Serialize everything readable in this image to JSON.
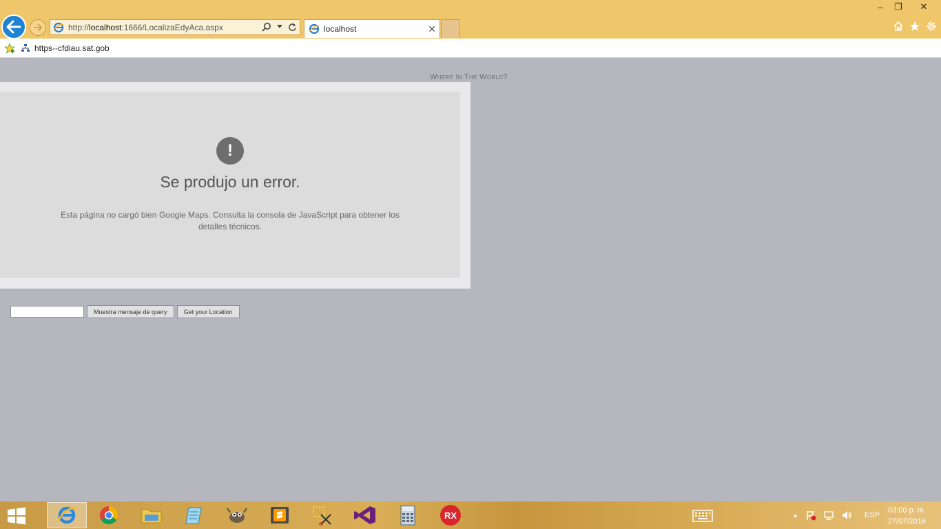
{
  "browser": {
    "address_url_prefix": "http://",
    "address_host": "localhost",
    "address_path": ":1666/LocalizaEdyAca.aspx",
    "tab_title": "localhost",
    "favorites": [
      {
        "label": "https--cfdiau.sat.gob"
      }
    ],
    "window_controls": {
      "minimize": "–",
      "restore": "❐",
      "close": "✕"
    }
  },
  "page": {
    "heading": "Where In The World?",
    "map_error": {
      "icon": "!",
      "title": "Se produjo un error.",
      "message": "Esta página no cargó bien Google Maps. Consulta la consola de JavaScript para obtener los detalles técnicos."
    },
    "form": {
      "query_value": "",
      "query_button": "Muestra mensaje de query",
      "location_button": "Get your Location"
    }
  },
  "taskbar": {
    "apps": [
      {
        "name": "internet-explorer",
        "active": true
      },
      {
        "name": "chrome"
      },
      {
        "name": "file-explorer"
      },
      {
        "name": "notepad"
      },
      {
        "name": "gimp"
      },
      {
        "name": "sublime-text"
      },
      {
        "name": "snipping-tool"
      },
      {
        "name": "visual-studio"
      },
      {
        "name": "calculator"
      },
      {
        "name": "rx-app",
        "label": "RX"
      }
    ],
    "language": "ESP",
    "time": "03:00 p. m.",
    "date": "27/07/2016"
  },
  "colors": {
    "titlebar": "#f0c66a",
    "page_bg": "#b6b7be",
    "back_button": "#1e83d3",
    "rx_badge": "#d9262e",
    "vs_purple": "#68217a"
  }
}
